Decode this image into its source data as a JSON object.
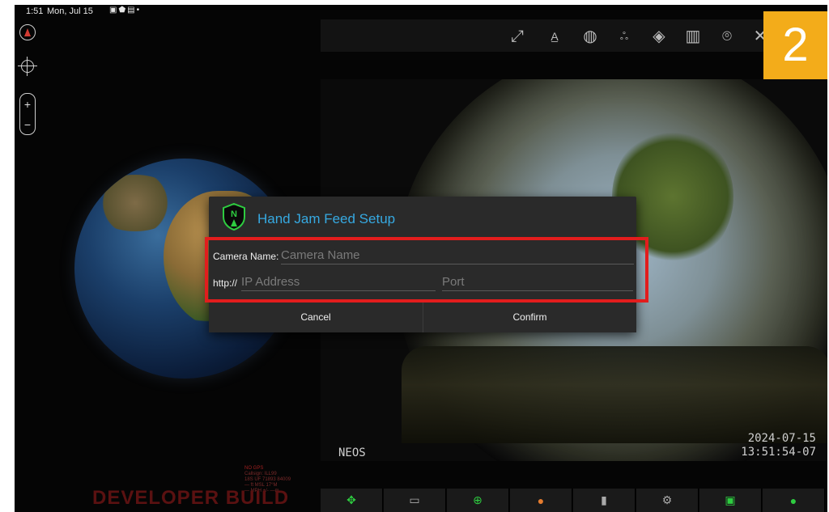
{
  "status_bar": {
    "time": "1:51",
    "date": "Mon, Jul 15",
    "icons": [
      "gallery-icon",
      "android-debug-icon",
      "screen-icon",
      "dot-icon"
    ]
  },
  "map_controls": {
    "zoom_in": "+",
    "zoom_out": "−"
  },
  "toolbar": {
    "icons": [
      "resize-icon",
      "measure-icon",
      "globe-icon",
      "group-icon",
      "layers-icon",
      "map-icon",
      "add-location-icon",
      "tools-icon"
    ]
  },
  "step_badge": "2",
  "camera_feed": {
    "label": "NEOS",
    "date": "2024-07-15",
    "time": "13:51:54-07"
  },
  "dialog": {
    "title": "Hand Jam Feed Setup",
    "camera_name_label": "Camera Name:",
    "camera_name_placeholder": "Camera Name",
    "http_label": "http://",
    "ip_placeholder": "IP Address",
    "port_placeholder": "Port",
    "cancel_label": "Cancel",
    "confirm_label": "Confirm"
  },
  "info_overlay": {
    "gps": "NO GPS",
    "callsign": "Callsign: ILL99",
    "coords": "18S UF 71893 84009",
    "msl": "— ft MSL",
    "heading": "17°M",
    "speed": "— MPH",
    "accuracy": "+/- —m"
  },
  "developer_build": "DEVELOPER BUILD",
  "bottom_toolbar": {
    "icons": [
      "pan-arrows-icon",
      "video-icon",
      "target-icon",
      "color-wheel-icon",
      "panel-icon",
      "gear-icon",
      "camera-frame-icon",
      "status-dot-icon"
    ]
  },
  "colors": {
    "accent_title": "#36a9e1",
    "highlight": "#e21d1d",
    "badge": "#f3ac1a",
    "shield_green": "#2ecc40"
  }
}
